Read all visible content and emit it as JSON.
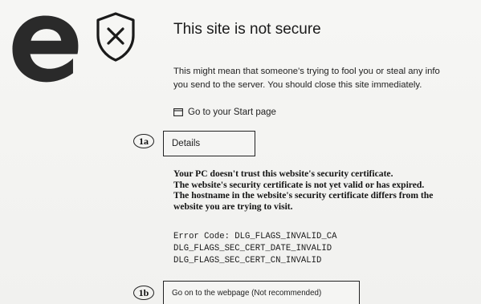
{
  "logo": {
    "icon": "edge-logo-icon",
    "color": "#2a2a2a"
  },
  "status_icon": {
    "icon": "shield-x-icon"
  },
  "page": {
    "title": "This site is not secure",
    "message_line1": "This might mean that someone's trying to fool you or steal any info",
    "message_line2": "you send to the server. You should close this site immediately.",
    "start_page_link": "Go to your Start page",
    "start_page_icon": "home-window-icon"
  },
  "annotations": {
    "marker_a": "1a",
    "marker_b": "1b"
  },
  "details": {
    "button_label": "Details",
    "reasons": [
      "Your PC doesn't trust this website's security certificate.",
      "The website's security certificate is not yet valid or has expired.",
      "The hostname in the website's security certificate differs from the",
      "website you are trying to visit."
    ],
    "error_codes": [
      "Error Code: DLG_FLAGS_INVALID_CA",
      "DLG_FLAGS_SEC_CERT_DATE_INVALID",
      "DLG_FLAGS_SEC_CERT_CN_INVALID"
    ]
  },
  "go_on": {
    "button_label": "Go on to the webpage (Not recommended)"
  }
}
